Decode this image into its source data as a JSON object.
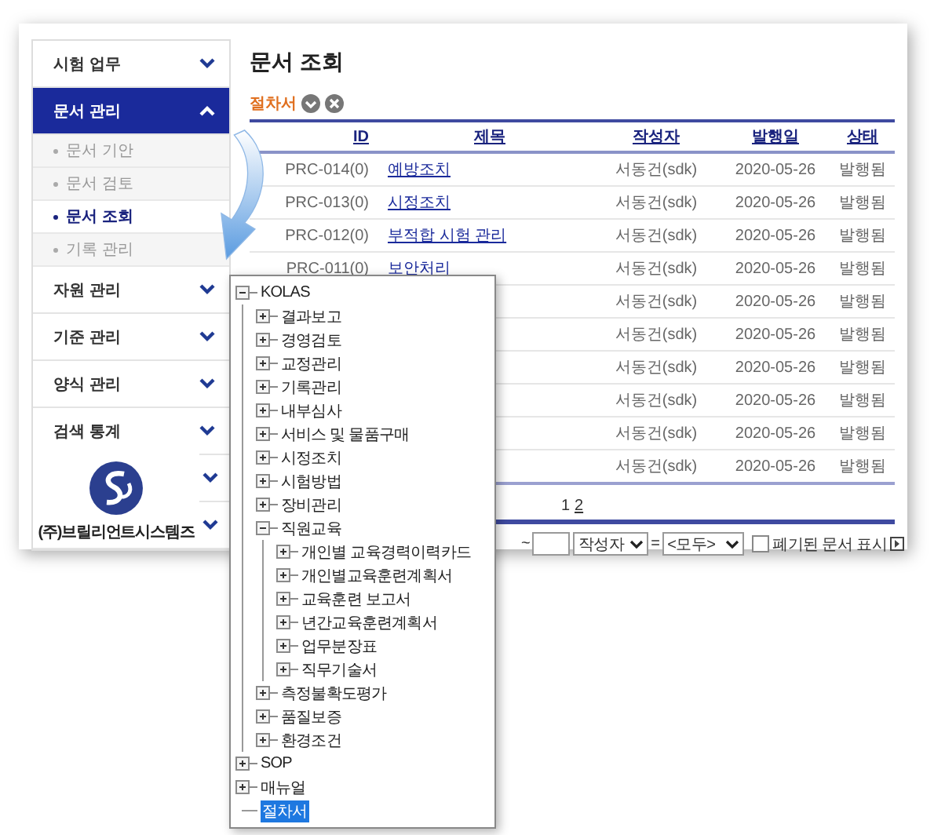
{
  "sidebar": {
    "items": [
      {
        "kind": "menu",
        "label": "시험 업무",
        "expanded": false
      },
      {
        "kind": "menu",
        "label": "문서 관리",
        "expanded": true
      },
      {
        "kind": "sub",
        "label": "문서 기안",
        "selected": false
      },
      {
        "kind": "sub",
        "label": "문서 검토",
        "selected": false
      },
      {
        "kind": "sub",
        "label": "문서 조회",
        "selected": true
      },
      {
        "kind": "sub",
        "label": "기록 관리",
        "selected": false
      },
      {
        "kind": "menu",
        "label": "자원 관리",
        "expanded": false
      },
      {
        "kind": "menu",
        "label": "기준 관리",
        "expanded": false
      },
      {
        "kind": "menu",
        "label": "양식 관리",
        "expanded": false
      },
      {
        "kind": "menu",
        "label": "검색 통계",
        "expanded": false
      },
      {
        "kind": "menu",
        "expanded": false
      },
      {
        "kind": "menu",
        "expanded": false
      }
    ],
    "company": "(주)브릴리언트시스템즈"
  },
  "page_title": "문서 조회",
  "breadcrumb": "절차서",
  "table": {
    "columns": [
      "ID",
      "제목",
      "작성자",
      "발행일",
      "상태"
    ],
    "rows": [
      {
        "id": "PRC-014(0)",
        "title": "예방조치",
        "author": "서동건(sdk)",
        "date": "2020-05-26",
        "status": "발행됨"
      },
      {
        "id": "PRC-013(0)",
        "title": "시정조치",
        "author": "서동건(sdk)",
        "date": "2020-05-26",
        "status": "발행됨"
      },
      {
        "id": "PRC-012(0)",
        "title": "부적합 시험 관리",
        "author": "서동건(sdk)",
        "date": "2020-05-26",
        "status": "발행됨"
      },
      {
        "id": "PRC-011(0)",
        "title": "보안처리",
        "author": "서동건(sdk)",
        "date": "2020-05-26",
        "status": "발행됨"
      },
      {
        "author": "서동건(sdk)",
        "date": "2020-05-26",
        "status": "발행됨"
      },
      {
        "author": "서동건(sdk)",
        "date": "2020-05-26",
        "status": "발행됨"
      },
      {
        "author": "서동건(sdk)",
        "date": "2020-05-26",
        "status": "발행됨"
      },
      {
        "author": "서동건(sdk)",
        "date": "2020-05-26",
        "status": "발행됨"
      },
      {
        "author": "서동건(sdk)",
        "date": "2020-05-26",
        "status": "발행됨"
      },
      {
        "author": "서동건(sdk)",
        "date": "2020-05-26",
        "status": "발행됨"
      }
    ]
  },
  "pagination": [
    {
      "label": "1",
      "selected": true
    },
    {
      "label": "2",
      "selected": false
    }
  ],
  "filter": {
    "range_separator": "~",
    "field_select": "작성자",
    "equals": "=",
    "value_select": "<모두>",
    "show_discarded": {
      "label": "폐기된 문서 표시",
      "checked": false
    }
  },
  "tree": [
    {
      "label": "KOLAS",
      "expanded": true,
      "selected": false,
      "children": [
        {
          "label": "결과보고",
          "expanded": false,
          "selected": false
        },
        {
          "label": "경영검토",
          "expanded": false,
          "selected": false
        },
        {
          "label": "교정관리",
          "expanded": false,
          "selected": false
        },
        {
          "label": "기록관리",
          "expanded": false,
          "selected": false
        },
        {
          "label": "내부심사",
          "expanded": false,
          "selected": false
        },
        {
          "label": "서비스 및 물품구매",
          "expanded": false,
          "selected": false
        },
        {
          "label": "시정조치",
          "expanded": false,
          "selected": false
        },
        {
          "label": "시험방법",
          "expanded": false,
          "selected": false
        },
        {
          "label": "장비관리",
          "expanded": false,
          "selected": false
        },
        {
          "label": "직원교육",
          "expanded": true,
          "selected": false,
          "children": [
            {
              "label": "개인별 교육경력이력카드",
              "expanded": false,
              "selected": false
            },
            {
              "label": "개인별교육훈련계획서",
              "expanded": false,
              "selected": false
            },
            {
              "label": "교육훈련 보고서",
              "expanded": false,
              "selected": false
            },
            {
              "label": "년간교육훈련계획서",
              "expanded": false,
              "selected": false
            },
            {
              "label": "업무분장표",
              "expanded": false,
              "selected": false
            },
            {
              "label": "직무기술서",
              "expanded": false,
              "selected": false
            }
          ]
        },
        {
          "label": "측정불확도평가",
          "expanded": false,
          "selected": false
        },
        {
          "label": "품질보증",
          "expanded": false,
          "selected": false
        },
        {
          "label": "환경조건",
          "expanded": false,
          "selected": false
        }
      ]
    },
    {
      "label": "SOP",
      "expanded": false,
      "selected": false
    },
    {
      "label": "매뉴얼",
      "expanded": false,
      "selected": false
    },
    {
      "label": "절차서",
      "selected": true
    }
  ]
}
